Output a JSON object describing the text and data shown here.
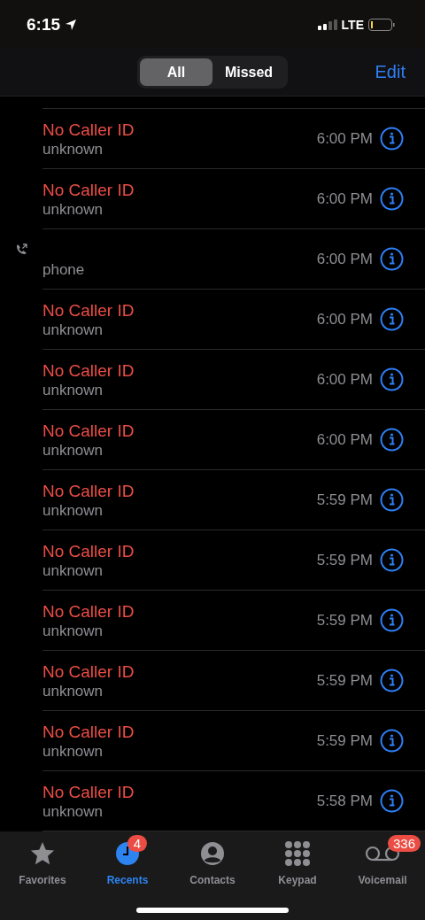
{
  "status_bar": {
    "time": "6:15",
    "network": "LTE"
  },
  "segments": [
    {
      "label": "All",
      "selected": true
    },
    {
      "label": "Missed",
      "selected": false
    }
  ],
  "edit_button": "Edit",
  "calls": [
    {
      "kind": "missed",
      "name": "No Caller ID",
      "type": "unknown",
      "time": "6:00 PM"
    },
    {
      "kind": "missed",
      "name": "No Caller ID",
      "type": "unknown",
      "time": "6:00 PM"
    },
    {
      "kind": "outgoing",
      "type": "phone",
      "time": "6:00 PM"
    },
    {
      "kind": "missed",
      "name": "No Caller ID",
      "type": "unknown",
      "time": "6:00 PM"
    },
    {
      "kind": "missed",
      "name": "No Caller ID",
      "type": "unknown",
      "time": "6:00 PM"
    },
    {
      "kind": "missed",
      "name": "No Caller ID",
      "type": "unknown",
      "time": "6:00 PM"
    },
    {
      "kind": "missed",
      "name": "No Caller ID",
      "type": "unknown",
      "time": "5:59 PM"
    },
    {
      "kind": "missed",
      "name": "No Caller ID",
      "type": "unknown",
      "time": "5:59 PM"
    },
    {
      "kind": "missed",
      "name": "No Caller ID",
      "type": "unknown",
      "time": "5:59 PM"
    },
    {
      "kind": "missed",
      "name": "No Caller ID",
      "type": "unknown",
      "time": "5:59 PM"
    },
    {
      "kind": "missed",
      "name": "No Caller ID",
      "type": "unknown",
      "time": "5:59 PM"
    },
    {
      "kind": "missed",
      "name": "No Caller ID",
      "type": "unknown",
      "time": "5:58 PM"
    }
  ],
  "tab_bar": [
    {
      "kind": "star",
      "label": "Favorites",
      "selected": false
    },
    {
      "kind": "clock",
      "label": "Recents",
      "selected": true,
      "badge": "4"
    },
    {
      "kind": "person",
      "label": "Contacts",
      "selected": false
    },
    {
      "kind": "keypad",
      "label": "Keypad",
      "selected": false
    },
    {
      "kind": "voicemail",
      "label": "Voicemail",
      "selected": false,
      "badge": "336"
    }
  ]
}
